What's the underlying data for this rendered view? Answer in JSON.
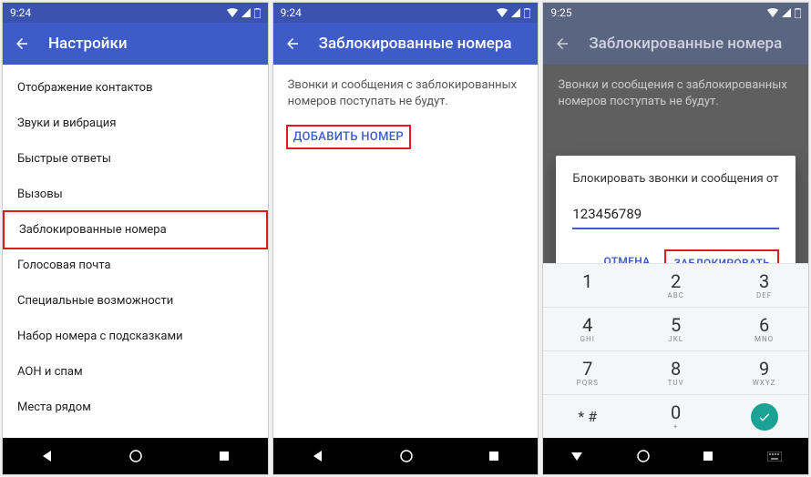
{
  "phone1": {
    "time": "9:24",
    "title": "Настройки",
    "items": [
      "Отображение контактов",
      "Звуки и вибрация",
      "Быстрые ответы",
      "Вызовы",
      "Заблокированные номера",
      "Голосовая почта",
      "Специальные возможности",
      "Набор номера с подсказками",
      "АОН и спам",
      "Места рядом"
    ]
  },
  "phone2": {
    "time": "9:24",
    "title": "Заблокированные номера",
    "info": "Звонки и сообщения с заблокированных номеров поступать не будут.",
    "add": "ДОБАВИТЬ НОМЕР"
  },
  "phone3": {
    "time": "9:25",
    "title": "Заблокированные номера",
    "info": "Звонки и сообщения с заблокированных номеров поступать не будут.",
    "dialog": {
      "title": "Блокировать звонки и сообщения от",
      "value": "123456789",
      "cancel": "ОТМЕНА",
      "block": "ЗАБЛОКИРОВАТЬ"
    },
    "keypad": [
      {
        "d": "1",
        "s": ""
      },
      {
        "d": "2",
        "s": "ABC"
      },
      {
        "d": "3",
        "s": "DEF"
      },
      {
        "d": "4",
        "s": "GHI"
      },
      {
        "d": "5",
        "s": "JKL"
      },
      {
        "d": "6",
        "s": "MNO"
      },
      {
        "d": "7",
        "s": "PQRS"
      },
      {
        "d": "8",
        "s": "TUV"
      },
      {
        "d": "9",
        "s": "WXYZ"
      },
      {
        "d": "* #",
        "s": ""
      },
      {
        "d": "0",
        "s": "+"
      },
      {
        "d": "done",
        "s": ""
      }
    ]
  }
}
